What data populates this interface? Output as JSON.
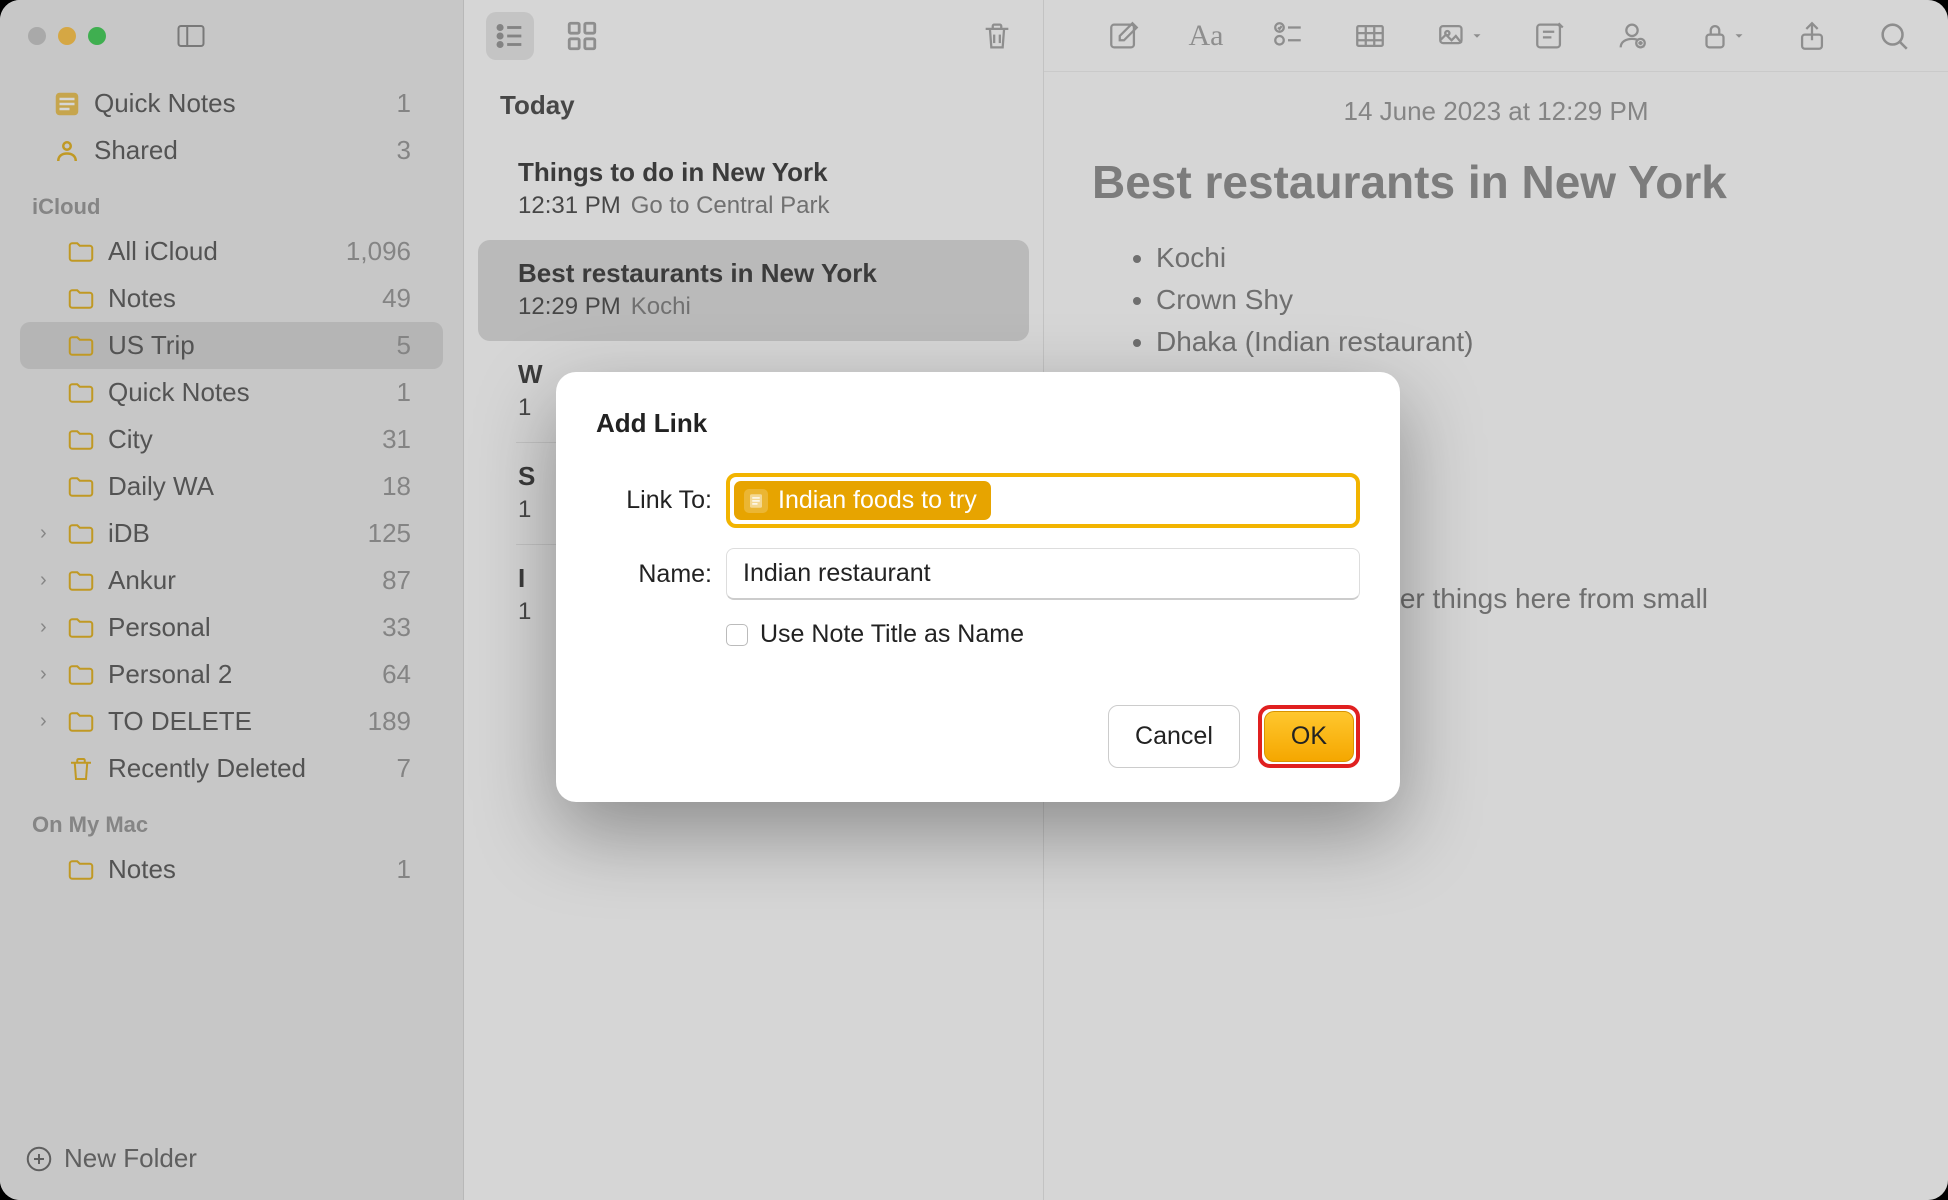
{
  "colors": {
    "accent": "#f5a700",
    "highlight_red": "#e02020"
  },
  "sidebar": {
    "top_items": [
      {
        "label": "Quick Notes",
        "count": "1",
        "icon": "quicknotes"
      },
      {
        "label": "Shared",
        "count": "3",
        "icon": "shared"
      }
    ],
    "sections": [
      {
        "title": "iCloud",
        "items": [
          {
            "label": "All iCloud",
            "count": "1,096",
            "chevron": false
          },
          {
            "label": "Notes",
            "count": "49",
            "chevron": false
          },
          {
            "label": "US Trip",
            "count": "5",
            "chevron": false,
            "selected": true
          },
          {
            "label": "Quick Notes",
            "count": "1",
            "chevron": false
          },
          {
            "label": "City",
            "count": "31",
            "chevron": false
          },
          {
            "label": "Daily WA",
            "count": "18",
            "chevron": false
          },
          {
            "label": "iDB",
            "count": "125",
            "chevron": true
          },
          {
            "label": "Ankur",
            "count": "87",
            "chevron": true
          },
          {
            "label": "Personal",
            "count": "33",
            "chevron": true
          },
          {
            "label": "Personal 2",
            "count": "64",
            "chevron": true
          },
          {
            "label": "TO DELETE",
            "count": "189",
            "chevron": true
          },
          {
            "label": "Recently Deleted",
            "count": "7",
            "chevron": false,
            "icon": "trash"
          }
        ]
      },
      {
        "title": "On My Mac",
        "items": [
          {
            "label": "Notes",
            "count": "1",
            "chevron": false
          }
        ]
      }
    ],
    "new_folder_label": "New Folder"
  },
  "notes_list": {
    "date_header": "Today",
    "items": [
      {
        "title": "Things to do in New York",
        "time": "12:31 PM",
        "preview": "Go to Central Park",
        "selected": false
      },
      {
        "title": "Best restaurants in New York",
        "time": "12:29 PM",
        "preview": "Kochi",
        "selected": true
      },
      {
        "title": "W",
        "time": "1",
        "preview": "",
        "selected": false
      },
      {
        "title": "S",
        "time": "1",
        "preview": "",
        "selected": false
      },
      {
        "title": "I",
        "time": "1",
        "preview": "",
        "selected": false
      }
    ]
  },
  "editor": {
    "date": "14 June 2023 at 12:29 PM",
    "title": "Best restaurants in New York",
    "bullets": [
      "Kochi",
      "Crown Shy",
      "Dhaka (Indian restaurant)"
    ],
    "paragraph_fragment": "ral other things here from small"
  },
  "modal": {
    "title": "Add Link",
    "link_to_label": "Link To:",
    "link_to_value": "Indian foods to try",
    "name_label": "Name:",
    "name_value": "Indian restaurant",
    "checkbox_label": "Use Note Title as Name",
    "checkbox_checked": false,
    "cancel_label": "Cancel",
    "ok_label": "OK"
  }
}
